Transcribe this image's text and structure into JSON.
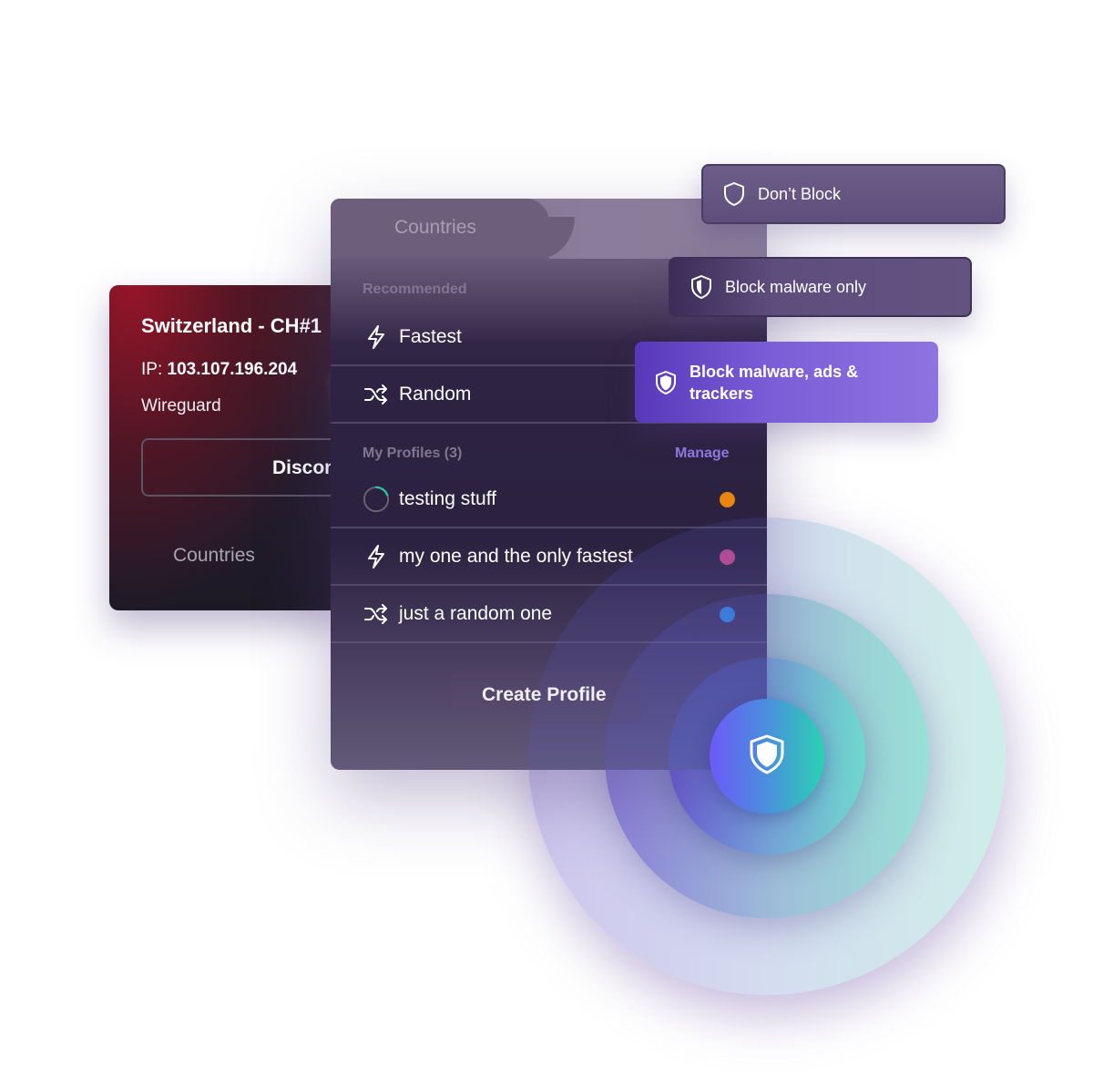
{
  "connection_card": {
    "server_name": "Switzerland - CH#1",
    "ip_label": "IP:",
    "ip_value": "103.107.196.204",
    "protocol": "Wireguard",
    "disconnect_label": "Disconnect",
    "countries_tab_label": "Countries"
  },
  "profiles_panel": {
    "tab_countries_label": "Countries",
    "recommended_label": "Recommended",
    "recommended_items": [
      {
        "label": "Fastest",
        "icon": "bolt-icon"
      },
      {
        "label": "Random",
        "icon": "shuffle-icon"
      }
    ],
    "my_profiles_label": "My Profiles (3)",
    "manage_label": "Manage",
    "profiles": [
      {
        "label": "testing stuff",
        "icon": "spinner-icon",
        "color": "#e8860f"
      },
      {
        "label": "my one and the only fastest",
        "icon": "bolt-icon",
        "color": "#c24a8c"
      },
      {
        "label": "just a random one",
        "icon": "shuffle-icon",
        "color": "#2e8ee0"
      }
    ],
    "create_profile_label": "Create Profile"
  },
  "netshield_options": [
    {
      "label": "Don’t Block",
      "icon": "shield-outline-icon"
    },
    {
      "label": "Block malware only",
      "icon": "shield-half-icon"
    },
    {
      "label": "Block malware, ads &\ntrackers",
      "icon": "shield-filled-icon",
      "selected": true
    }
  ],
  "colors": {
    "accent": "#8e7ae0",
    "selected_option": "#7a5ed8",
    "orb_gradient_start": "#6b5af8",
    "orb_gradient_end": "#2ad2b4"
  }
}
